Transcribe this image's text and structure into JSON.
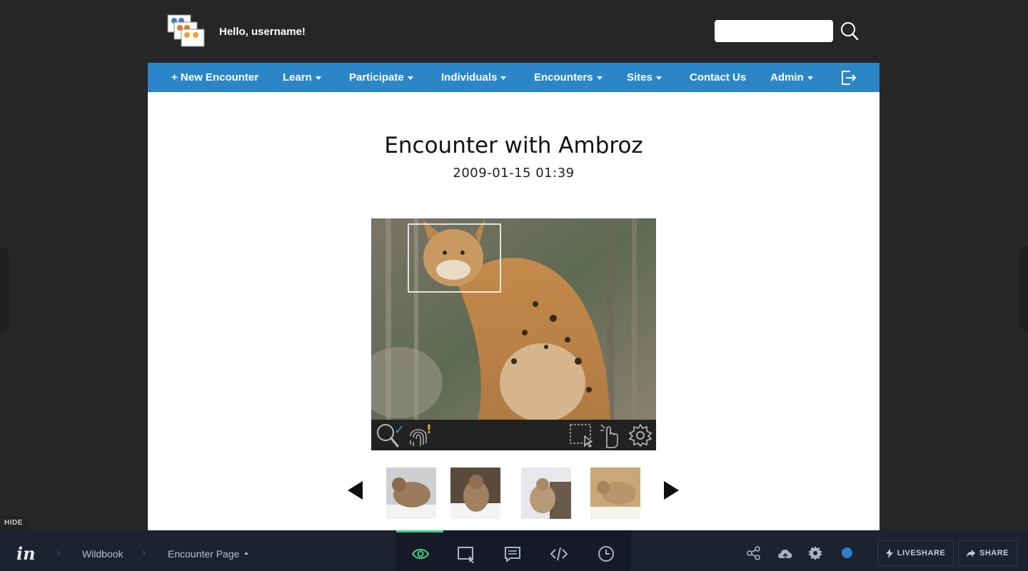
{
  "header": {
    "greeting": "Hello, username!",
    "search_placeholder": ""
  },
  "nav": {
    "items": [
      {
        "label": "+ New Encounter",
        "dropdown": false
      },
      {
        "label": "Learn",
        "dropdown": true
      },
      {
        "label": "Participate",
        "dropdown": true
      },
      {
        "label": "Individuals",
        "dropdown": true
      },
      {
        "label": "Encounters",
        "dropdown": true
      },
      {
        "label": "Sites",
        "dropdown": true
      },
      {
        "label": "Contact Us",
        "dropdown": false
      },
      {
        "label": "Admin",
        "dropdown": true
      }
    ]
  },
  "encounter": {
    "title": "Encounter with Ambroz",
    "datetime": "2009-01-15 01:39"
  },
  "photo_toolbar": {
    "match_status_mark": "✓",
    "fingerprint_status_mark": "!"
  },
  "bottombar": {
    "hide_label": "HIDE",
    "breadcrumb_project": "Wildbook",
    "breadcrumb_screen": "Encounter Page",
    "liveshare_label": "LIVESHARE",
    "share_label": "SHARE"
  },
  "colors": {
    "nav_blue": "#2b86c8",
    "page_bg": "#262626",
    "active_tool_green": "#3ecf8e",
    "status_dot_blue": "#2d7fc9"
  }
}
